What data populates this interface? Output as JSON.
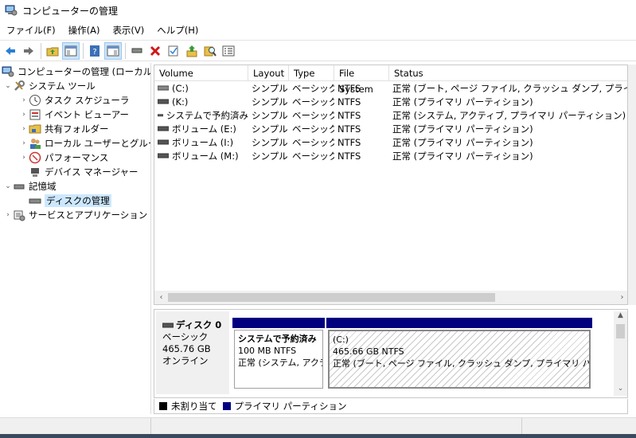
{
  "window": {
    "title": "コンピューターの管理"
  },
  "menu": [
    "ファイル(F)",
    "操作(A)",
    "表示(V)",
    "ヘルプ(H)"
  ],
  "tree": {
    "root": "コンピューターの管理 (ローカル)",
    "system_tools": "システム ツール",
    "task_scheduler": "タスク スケジューラ",
    "event_viewer": "イベント ビューアー",
    "shared_folders": "共有フォルダー",
    "local_users": "ローカル ユーザーとグループ",
    "performance": "パフォーマンス",
    "device_manager": "デバイス マネージャー",
    "storage": "記憶域",
    "disk_management": "ディスクの管理",
    "services_apps": "サービスとアプリケーション"
  },
  "volume_table": {
    "headers": [
      "Volume",
      "Layout",
      "Type",
      "File System",
      "Status"
    ],
    "rows": [
      {
        "volume": "(C:)",
        "layout": "シンプル",
        "type": "ベーシック",
        "fs": "NTFS",
        "status": "正常 (ブート, ページ ファイル, クラッシュ ダンプ, プライマリ パーティ"
      },
      {
        "volume": "(K:)",
        "layout": "シンプル",
        "type": "ベーシック",
        "fs": "NTFS",
        "status": "正常 (プライマリ パーティション)"
      },
      {
        "volume": "システムで予約済み",
        "layout": "シンプル",
        "type": "ベーシック",
        "fs": "NTFS",
        "status": "正常 (システム, アクティブ, プライマリ パーティション)"
      },
      {
        "volume": "ボリューム (E:)",
        "layout": "シンプル",
        "type": "ベーシック",
        "fs": "NTFS",
        "status": "正常 (プライマリ パーティション)"
      },
      {
        "volume": "ボリューム (I:)",
        "layout": "シンプル",
        "type": "ベーシック",
        "fs": "NTFS",
        "status": "正常 (プライマリ パーティション)"
      },
      {
        "volume": "ボリューム (M:)",
        "layout": "シンプル",
        "type": "ベーシック",
        "fs": "NTFS",
        "status": "正常 (プライマリ パーティション)"
      }
    ]
  },
  "disk0": {
    "name": "ディスク 0",
    "type": "ベーシック",
    "size": "465.76 GB",
    "state": "オンライン",
    "partitions": [
      {
        "name": "システムで予約済み",
        "size_fs": "100 MB NTFS",
        "status": "正常 (システム, アクテ"
      },
      {
        "name": "(C:)",
        "size_fs": "465.66 GB NTFS",
        "status": "正常 (ブート, ページ ファイル, クラッシュ ダンプ, プライマリ パーティション"
      }
    ]
  },
  "legend": {
    "unallocated": "未割り当て",
    "primary": "プライマリ パーティション",
    "colors": {
      "unallocated": "#000000",
      "primary": "#00007f"
    }
  },
  "icons": [
    "back-icon",
    "forward-icon",
    "up-folder-icon",
    "show-hide-tree-icon",
    "help-icon",
    "properties-icon",
    "connect-icon",
    "delete-icon",
    "check-icon",
    "import-icon",
    "search-icon",
    "list-icon"
  ]
}
